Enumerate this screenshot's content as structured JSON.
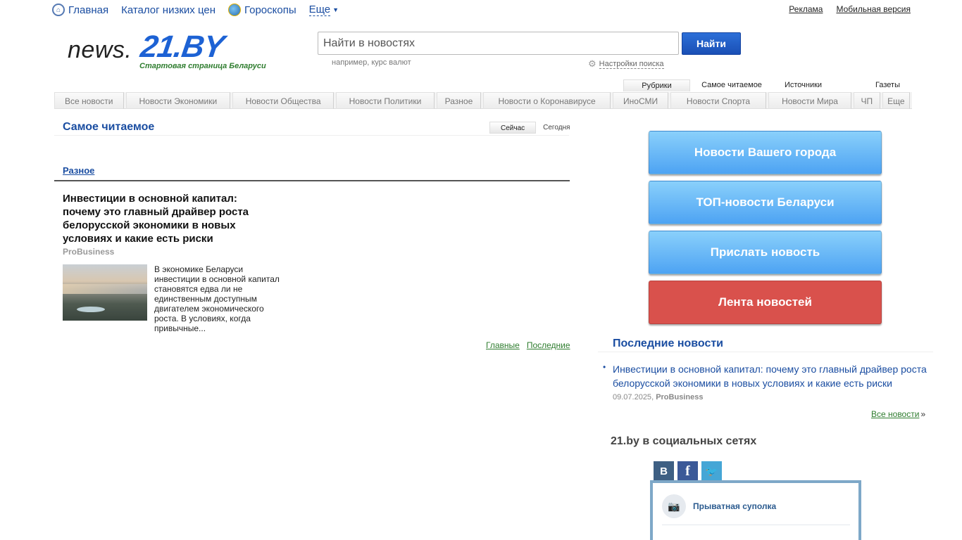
{
  "topnav": {
    "items": [
      {
        "label": "Главная",
        "icon": "home-icon"
      },
      {
        "label": "Каталог низких цен"
      },
      {
        "label": "Гороскопы",
        "icon": "globe-icon"
      }
    ],
    "more_label": "Еще",
    "right_links": [
      "Реклама",
      "Мобильная версия"
    ]
  },
  "logo": {
    "news": "news.",
    "brand": "21.BY",
    "tagline": "Стартовая страница Беларуси",
    "brand_color": "#1d62d4"
  },
  "search": {
    "placeholder": "Найти в новостях",
    "button_label": "Найти",
    "hint": "например, курс валют",
    "settings_label": "Настройки поиска"
  },
  "view_tabs": [
    "Рубрики",
    "Самое читаемое",
    "Источники",
    "Газеты"
  ],
  "categories": [
    "Все новости",
    "Новости Экономики",
    "Новости Общества",
    "Новости Политики",
    "Разное",
    "Новости о Коронавирусе",
    "ИноСМИ",
    "Новости Спорта",
    "Новости Мира",
    "ЧП",
    "Еще"
  ],
  "most_read": {
    "title": "Самое читаемое",
    "switch": [
      "Сейчас",
      "Сегодня"
    ],
    "section": "Разное",
    "article": {
      "headline": "Инвестиции в основной капитал: почему это главный драйвер роста белорусской экономики в новых условиях и какие есть риски",
      "source": "ProBusiness",
      "excerpt": "В экономике Беларуси инвестиции в основной капитал становятся едва ли не единственным доступным двигателем экономического роста. В условиях, когда привычные..."
    },
    "bottom_links": [
      "Главные",
      "Последние"
    ]
  },
  "sidebar": {
    "buttons": [
      {
        "label": "Новости Вашего города",
        "color": "#5aaef5"
      },
      {
        "label": "ТОП-новости Беларуси",
        "color": "#5aaef5"
      },
      {
        "label": "Прислать новость",
        "color": "#5aaef5"
      },
      {
        "label": "Лента новостей",
        "color": "#d9514c"
      }
    ],
    "latest": {
      "title": "Последние новости",
      "item": "Инвестиции в основной капитал: почему это главный драйвер роста белорусской экономики в новых условиях и какие есть риски",
      "date": "09.07.2025",
      "source": "ProBusiness",
      "all_label": "Все новости",
      "all_suffix": "»"
    },
    "social": {
      "title": "21.by в социальных сетях",
      "tabs": [
        {
          "label": "В",
          "icon": "vk-icon"
        },
        {
          "label": "f",
          "icon": "facebook-icon"
        },
        {
          "label": "🐦",
          "icon": "twitter-icon"
        }
      ],
      "group_name": "Прыватная суполка",
      "avatar_icon": "camera-icon"
    }
  }
}
